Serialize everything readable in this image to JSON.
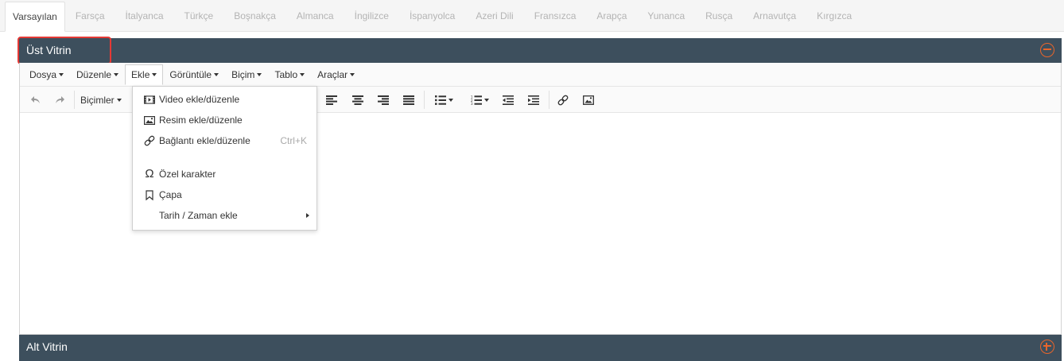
{
  "languages": {
    "tabs": [
      "Varsayılan",
      "Farsça",
      "İtalyanca",
      "Türkçe",
      "Boşnakça",
      "Almanca",
      "İngilizce",
      "İspanyolca",
      "Azeri Dili",
      "Fransızca",
      "Arapça",
      "Yunanca",
      "Rusça",
      "Arnavutça",
      "Kırgızca"
    ],
    "active": "Varsayılan"
  },
  "sections": {
    "top": {
      "title": "Üst Vitrin",
      "toggle": "collapse"
    },
    "bottom": {
      "title": "Alt Vitrin",
      "toggle": "expand"
    }
  },
  "editor": {
    "menubar": [
      "Dosya",
      "Düzenle",
      "Ekle",
      "Görüntüle",
      "Biçim",
      "Tablo",
      "Araçlar"
    ],
    "active_menu": "Ekle",
    "toolbar": {
      "formats_label": "Biçimler",
      "buttons": [
        "undo-icon",
        "redo-icon",
        "align-left-icon",
        "align-center-icon",
        "align-right-icon",
        "align-justify-icon",
        "bullet-list-icon",
        "numbered-list-icon",
        "outdent-icon",
        "indent-icon",
        "link-icon",
        "image-icon"
      ]
    }
  },
  "insert_menu": {
    "items": [
      {
        "label": "Video ekle/düzenle",
        "icon": "video-icon",
        "shortcut": ""
      },
      {
        "label": "Resim ekle/düzenle",
        "icon": "image-icon",
        "shortcut": ""
      },
      {
        "label": "Bağlantı ekle/düzenle",
        "icon": "link-icon",
        "shortcut": "Ctrl+K"
      },
      {
        "label": "Özel karakter",
        "icon": "omega-icon",
        "shortcut": ""
      },
      {
        "label": "Çapa",
        "icon": "bookmark-icon",
        "shortcut": ""
      },
      {
        "label": "Tarih / Zaman ekle",
        "icon": "",
        "shortcut": "",
        "submenu": true
      }
    ]
  },
  "colors": {
    "section_bar": "#3d4f5d",
    "toggle_accent": "#e8652b",
    "highlight_border": "#e53935"
  }
}
